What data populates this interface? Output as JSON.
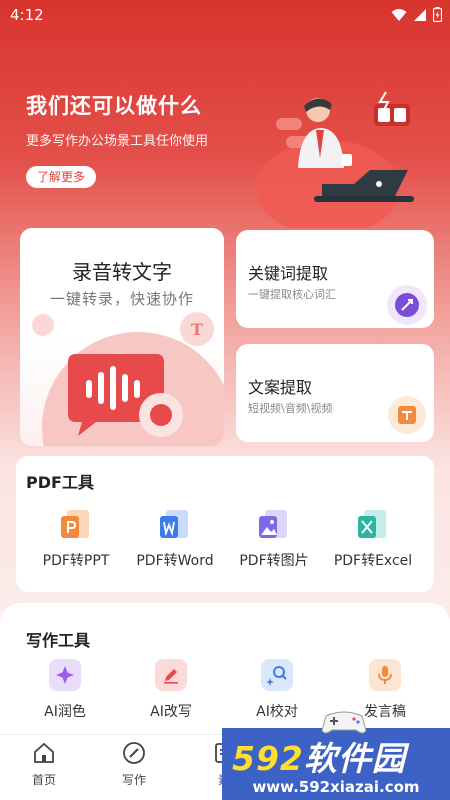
{
  "status_bar": {
    "time": "4:12"
  },
  "hero": {
    "title": "我们还可以做什么",
    "subtitle": "更多写作办公场景工具任你使用",
    "button": "了解更多"
  },
  "cards": {
    "recorder": {
      "title": "录音转文字",
      "subtitle": "一键转录，快速协作"
    },
    "keyword": {
      "title": "关键词提取",
      "subtitle": "一键提取核心词汇"
    },
    "copy": {
      "title": "文案提取",
      "subtitle": "短视频\\音频\\视频"
    }
  },
  "pdf_tools": {
    "title": "PDF工具",
    "items": [
      {
        "label": "PDF转PPT",
        "icon": "ppt-icon",
        "color": "#f08a3c"
      },
      {
        "label": "PDF转Word",
        "icon": "word-icon",
        "color": "#3f7be8"
      },
      {
        "label": "PDF转图片",
        "icon": "image-icon",
        "color": "#7a6ae8"
      },
      {
        "label": "PDF转Excel",
        "icon": "excel-icon",
        "color": "#2ab6a3"
      }
    ]
  },
  "writing_tools": {
    "title": "写作工具",
    "items": [
      {
        "label": "AI润色",
        "icon": "star-polish-icon",
        "color": "#9b5de5"
      },
      {
        "label": "AI改写",
        "icon": "pencil-icon",
        "color": "#e64a4a"
      },
      {
        "label": "AI校对",
        "icon": "search-check-icon",
        "color": "#3d7be0"
      },
      {
        "label": "发言稿",
        "icon": "microphone-icon",
        "color": "#f08a3c"
      }
    ]
  },
  "bottom_nav": [
    {
      "label": "首页",
      "icon": "home-icon"
    },
    {
      "label": "写作",
      "icon": "compass-icon"
    },
    {
      "label": "素",
      "icon": "document-icon"
    }
  ],
  "watermark": {
    "logo_text": "592软件园",
    "url": "www.592xiazai.com"
  },
  "colors": {
    "brand_red": "#e0433b",
    "accent_pink": "#f7c7c4"
  }
}
